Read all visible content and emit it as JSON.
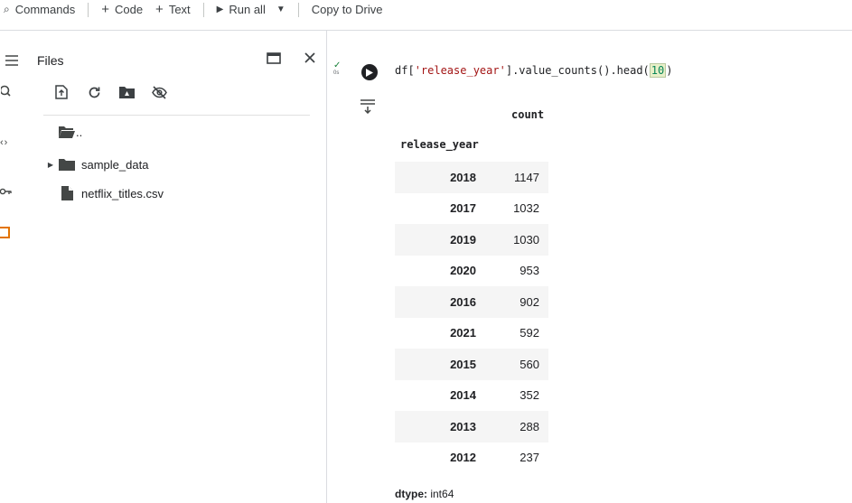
{
  "toolbar": {
    "commands_label": "Commands",
    "code_label": "Code",
    "text_label": "Text",
    "run_all_label": "Run all",
    "copy_to_drive_label": "Copy to Drive"
  },
  "files_panel": {
    "title": "Files",
    "tree": [
      {
        "label": "..",
        "icon": "folder-open-icon"
      },
      {
        "label": "sample_data",
        "icon": "folder-icon"
      },
      {
        "label": "netflix_titles.csv",
        "icon": "file-icon"
      }
    ]
  },
  "cell": {
    "status_mark": "✓",
    "status_time": "0s",
    "code_prefix": "df[",
    "code_string": "'release_year'",
    "code_middle": "].value_counts().head(",
    "code_number": "10",
    "code_suffix": ")"
  },
  "output": {
    "column_header": "count",
    "index_name": "release_year",
    "rows": [
      {
        "year": "2018",
        "count": "1147"
      },
      {
        "year": "2017",
        "count": "1032"
      },
      {
        "year": "2019",
        "count": "1030"
      },
      {
        "year": "2020",
        "count": "953"
      },
      {
        "year": "2016",
        "count": "902"
      },
      {
        "year": "2021",
        "count": "592"
      },
      {
        "year": "2015",
        "count": "560"
      },
      {
        "year": "2014",
        "count": "352"
      },
      {
        "year": "2013",
        "count": "288"
      },
      {
        "year": "2012",
        "count": "237"
      }
    ],
    "dtype_label": "dtype:",
    "dtype_value": "int64"
  },
  "colors": {
    "run_button": "#202124",
    "string_literal": "#a31515",
    "number_literal": "#098658",
    "success_check": "#188038",
    "active_rail_icon": "#e37400"
  }
}
